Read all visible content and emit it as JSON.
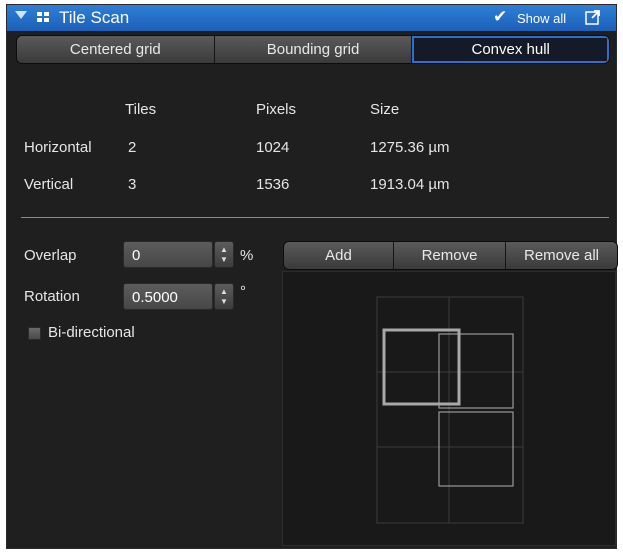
{
  "titlebar": {
    "title": "Tile Scan",
    "show_all_label": "Show all"
  },
  "tabs": [
    {
      "label": "Centered grid",
      "active": false
    },
    {
      "label": "Bounding grid",
      "active": false
    },
    {
      "label": "Convex hull",
      "active": true
    }
  ],
  "info": {
    "headers": {
      "tiles": "Tiles",
      "pixels": "Pixels",
      "size": "Size"
    },
    "rows": [
      {
        "label": "Horizontal",
        "tiles": "2",
        "pixels": "1024",
        "size": "1275.36 µm"
      },
      {
        "label": "Vertical",
        "tiles": "3",
        "pixels": "1536",
        "size": "1913.04 µm"
      }
    ]
  },
  "controls": {
    "overlap": {
      "label": "Overlap",
      "value": "0",
      "unit": "%"
    },
    "rotation": {
      "label": "Rotation",
      "value": "0.5000",
      "unit": "°"
    },
    "bidirectional": {
      "label": "Bi-directional",
      "checked": false
    }
  },
  "buttons": {
    "add": "Add",
    "remove": "Remove",
    "remove_all": "Remove all"
  }
}
